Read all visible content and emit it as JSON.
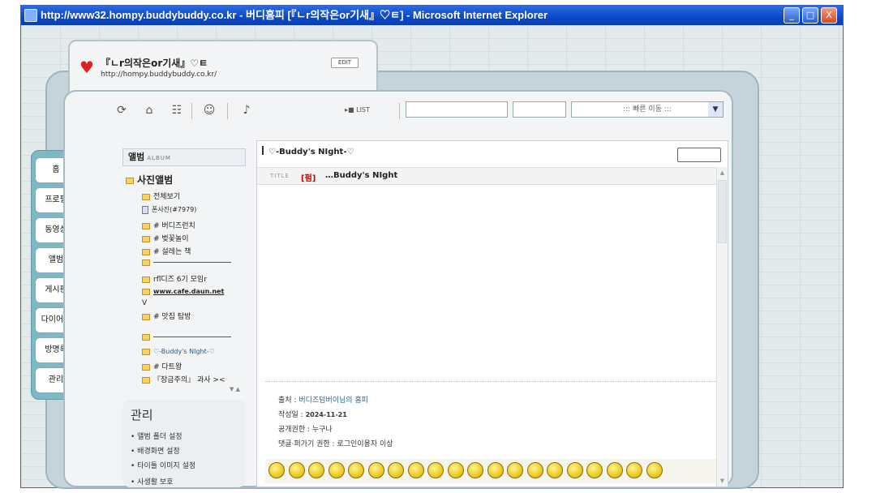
{
  "window": {
    "title": "http://www32.hompy.buddybuddy.co.kr - 버디홈피 [『ㄴr의작은or기새』♡ㅌ] - Microsoft Internet Explorer",
    "minimize": "_",
    "maximize": "□",
    "close": "X"
  },
  "header": {
    "home_title": "『ㄴr의작은or기새』♡ㅌ",
    "url": "http://hompy.buddybuddy.co.kr/",
    "edit_label": "EDIT"
  },
  "toolbar": {
    "list_label": "▸■ LIST",
    "quick_move": "::: 빠른 이동 :::",
    "quick_arrow": "▼"
  },
  "nav_tabs": [
    "홈",
    "프로필",
    "동영상",
    "앨범",
    "게시판",
    "다이어리",
    "방명록",
    "관리"
  ],
  "sidebar": {
    "album_label": "앨범",
    "album_sub": "ALBUM",
    "photo_album": "사진앨범",
    "items": [
      {
        "label": "전체보기",
        "icon": "folder-icon"
      },
      {
        "label": "폰사진(#7979)",
        "icon": "document-icon"
      },
      {
        "label": "# 버디즈런치",
        "icon": "folder-icon"
      },
      {
        "label": "# 벚꽃놀이",
        "icon": "folder-icon"
      },
      {
        "label": "# 설레는 책",
        "icon": "folder-icon"
      },
      {
        "label": "",
        "icon": "folder-icon"
      },
      {
        "label": "rfl디즈 6기 모임r",
        "icon": "folder-icon"
      },
      {
        "label": "www.cafe.daun.net",
        "icon": "folder-icon"
      },
      {
        "label": "V",
        "icon": ""
      },
      {
        "label": "# 맛집 탐방",
        "icon": "folder-icon"
      },
      {
        "label": "",
        "icon": "folder-icon"
      },
      {
        "label": "♡-Buddy's NIght-♡",
        "icon": "folder-icon"
      },
      {
        "label": "# 다트왕",
        "icon": "folder-icon"
      },
      {
        "label": "『장금주의』 과사 ><",
        "icon": "folder-icon"
      }
    ],
    "mini_arrows": "▼ ▲",
    "management_title": "관리",
    "management_items": [
      "앨범 폴더 설정",
      "배경화면 설정",
      "타이틀 이미지 설정",
      "사생활 보호"
    ]
  },
  "content": {
    "folder_title": "♡-Buddy's NIght-♡",
    "title_label": "TITLE",
    "title_tag": "[펌]",
    "title_text": "…Buddy's NIght",
    "scroll_up": "▲",
    "scroll_down": "▼",
    "source_label": "출처 :",
    "source_value": "버디즈덤버이님의 홈피",
    "date_label": "작성일 :",
    "date_value": "2024-11-21",
    "visibility": "공개권한 : 누구나",
    "comment_perm": "댓글·퍼가기 권한 : 로그인이용자 이상"
  },
  "emoticon_count": 20
}
